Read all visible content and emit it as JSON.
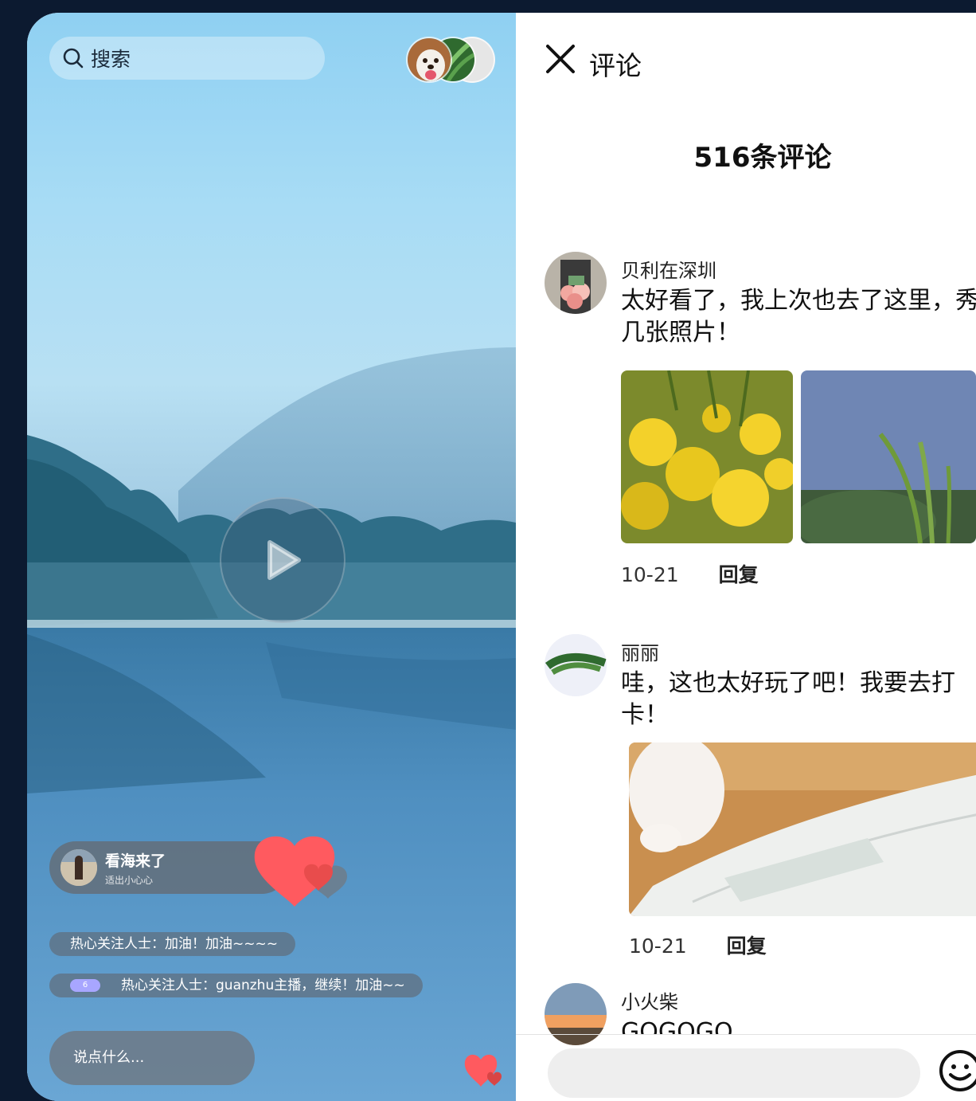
{
  "live": {
    "search_label": "搜索",
    "host": {
      "title": "看海来了",
      "subtitle": "适出小心心"
    },
    "messages": [
      {
        "text": "热心关注人士：加油！加油~~~~"
      },
      {
        "badge": "6",
        "text": "热心关注人士：guanzhu主播，继续！加油~~"
      }
    ],
    "comment_placeholder": "说点什么..."
  },
  "comments_panel": {
    "title": "评论",
    "count_label": "516条评论",
    "items": [
      {
        "user": "贝利在深圳",
        "text": "太好看了，我上次也去了这里，秀几张照片！",
        "date": "10-21",
        "reply": "回复"
      },
      {
        "user": "丽丽",
        "text": "哇，这也太好玩了吧！我要去打卡！",
        "date": "10-21",
        "reply": "回复"
      },
      {
        "user": "小火柴",
        "text": "GOGOGO"
      }
    ]
  },
  "icons": {
    "search": "search-icon",
    "close": "close-icon",
    "play": "play-icon",
    "heart": "heart-icon",
    "emoji": "emoji-icon"
  },
  "colors": {
    "heart": "#ff5a5f",
    "badge": "#a8a6ff"
  }
}
